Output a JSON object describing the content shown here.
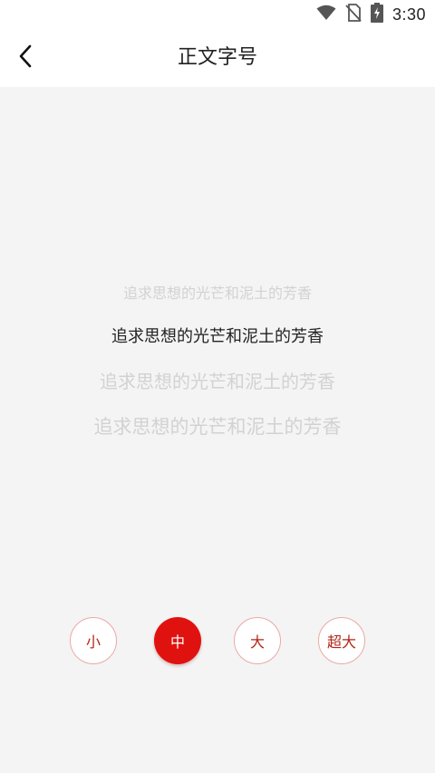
{
  "status_bar": {
    "time": "3:30",
    "icons": [
      "wifi-icon",
      "no-sim-icon",
      "battery-charging-icon"
    ]
  },
  "header": {
    "back_icon": "back-chevron-icon",
    "title": "正文字号"
  },
  "preview": {
    "small": "追求思想的光芒和泥土的芳香",
    "medium": "追求思想的光芒和泥土的芳香",
    "large": "追求思想的光芒和泥土的芳香",
    "xlarge": "追求思想的光芒和泥土的芳香"
  },
  "size_options": {
    "small": "小",
    "medium": "中",
    "large": "大",
    "xlarge": "超大",
    "selected": "中"
  },
  "colors": {
    "accent": "#e0120f",
    "accent_text": "#b32617",
    "active_text": "#222222",
    "inactive_text": "#d2d2d2",
    "background": "#f4f4f4"
  }
}
